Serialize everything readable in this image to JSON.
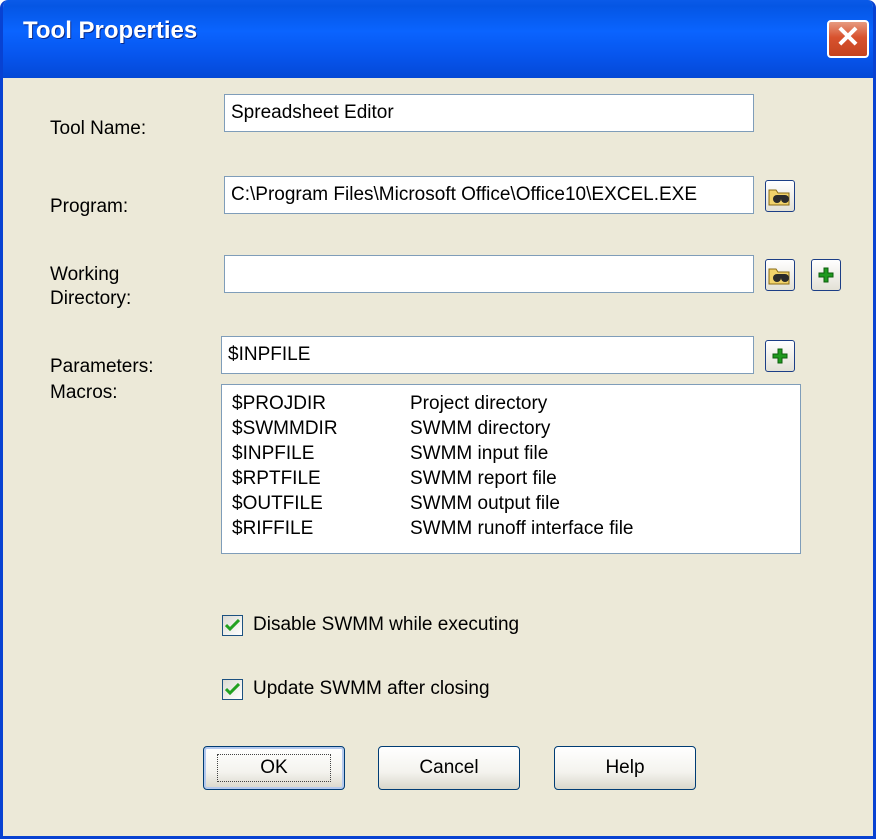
{
  "window": {
    "title": "Tool Properties",
    "close_glyph": "✕"
  },
  "fields": {
    "tool_name": {
      "label": "Tool Name:",
      "value": "Spreadsheet Editor"
    },
    "program": {
      "label": "Program:",
      "value": "C:\\Program Files\\Microsoft Office\\Office10\\EXCEL.EXE"
    },
    "working_directory": {
      "label_line1": "Working",
      "label_line2": "Directory:",
      "value": ""
    },
    "parameters": {
      "label": "Parameters:",
      "value": "$INPFILE"
    }
  },
  "macros": {
    "label": "Macros:",
    "items": [
      {
        "name": "$PROJDIR",
        "desc": "Project directory"
      },
      {
        "name": "$SWMMDIR",
        "desc": "SWMM directory"
      },
      {
        "name": "$INPFILE",
        "desc": "SWMM input file"
      },
      {
        "name": "$RPTFILE",
        "desc": "SWMM report file"
      },
      {
        "name": "$OUTFILE",
        "desc": "SWMM output file"
      },
      {
        "name": "$RIFFILE",
        "desc": "SWMM runoff interface file"
      }
    ]
  },
  "options": {
    "disable_swmm": {
      "label": "Disable SWMM while executing",
      "checked": true
    },
    "update_swmm": {
      "label": "Update SWMM after closing",
      "checked": true
    }
  },
  "buttons": {
    "ok": "OK",
    "cancel": "Cancel",
    "help": "Help"
  },
  "icons": {
    "browse": "binoculars-folder-icon",
    "add": "green-plus-icon",
    "check": "checkmark-icon"
  },
  "colors": {
    "titlebar": "#0a64ff",
    "dialog_bg": "#ece9d8",
    "close_button": "#d8522e",
    "check_green": "#21a121",
    "plus_green": "#1f9a1f"
  }
}
